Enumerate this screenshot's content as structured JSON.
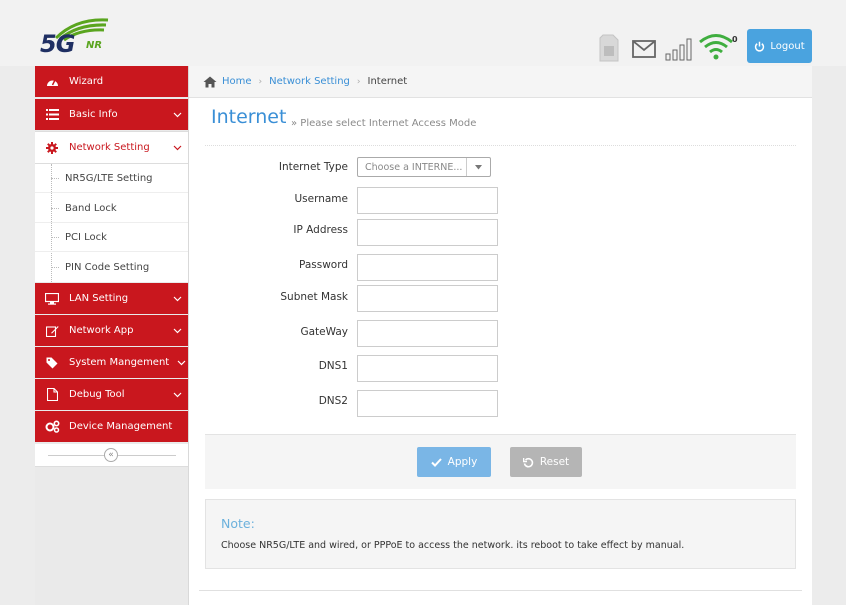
{
  "header": {
    "logo_main": "5G",
    "logo_sub": "NR",
    "wifi_clients": "0",
    "logout_label": "Logout",
    "colors": {
      "accent": "#4aa3df",
      "nav_red": "#c9171e"
    }
  },
  "sidebar": {
    "items": [
      {
        "label": "Wizard",
        "icon": "dashboard-icon"
      },
      {
        "label": "Basic Info",
        "icon": "list-icon"
      },
      {
        "label": "Network Setting",
        "icon": "gear-icon"
      },
      {
        "label": "LAN Setting",
        "icon": "monitor-icon"
      },
      {
        "label": "Network App",
        "icon": "edit-icon"
      },
      {
        "label": "System Mangement",
        "icon": "tag-icon"
      },
      {
        "label": "Debug Tool",
        "icon": "file-icon"
      },
      {
        "label": "Device Management",
        "icon": "gears-icon"
      }
    ],
    "submenu": [
      "NR5G/LTE Setting",
      "Band Lock",
      "PCI Lock",
      "PIN Code Setting"
    ],
    "collapse_glyph": "«"
  },
  "breadcrumb": {
    "home": "Home",
    "section": "Network Setting",
    "current": "Internet"
  },
  "page": {
    "title": "Internet",
    "subtitle": "» Please select Internet Access Mode"
  },
  "form": {
    "internet_type_label": "Internet Type",
    "internet_type_value": "Choose a INTERNE...",
    "username_label": "Username",
    "ip_label": "IP Address",
    "password_label": "Password",
    "subnet_label": "Subnet Mask",
    "gateway_label": "GateWay",
    "dns1_label": "DNS1",
    "dns2_label": "DNS2"
  },
  "actions": {
    "apply_label": "Apply",
    "reset_label": "Reset"
  },
  "note": {
    "title": "Note:",
    "text": "Choose NR5G/LTE and wired, or PPPoE to access the network. its reboot to take effect by manual."
  }
}
